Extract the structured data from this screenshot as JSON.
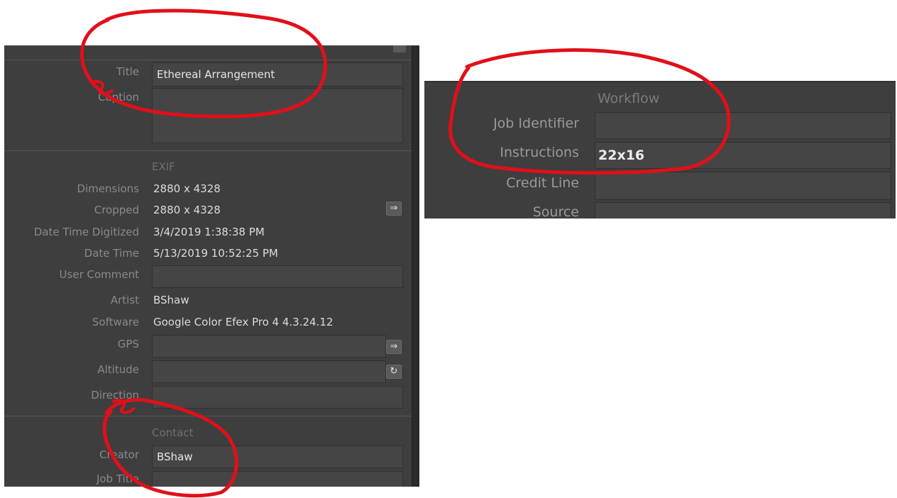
{
  "left_panel": {
    "iptc": {
      "title_label": "Title",
      "title_value": "Ethereal Arrangement",
      "caption_label": "Caption",
      "caption_value": ""
    },
    "exif": {
      "section_title": "EXIF",
      "dimensions_label": "Dimensions",
      "dimensions_value": "2880 x 4328",
      "cropped_label": "Cropped",
      "cropped_value": "2880 x 4328",
      "date_digitized_label": "Date Time Digitized",
      "date_digitized_value": "3/4/2019 1:38:38 PM",
      "date_time_label": "Date Time",
      "date_time_value": "5/13/2019 10:52:25 PM",
      "user_comment_label": "User Comment",
      "user_comment_value": "",
      "artist_label": "Artist",
      "artist_value": "BShaw",
      "software_label": "Software",
      "software_value": "Google Color Efex Pro 4 4.3.24.12",
      "gps_label": "GPS",
      "gps_value": "",
      "altitude_label": "Altitude",
      "altitude_value": "",
      "direction_label": "Direction",
      "direction_value": ""
    },
    "contact": {
      "section_title": "Contact",
      "creator_label": "Creator",
      "creator_value": "BShaw",
      "job_title_label": "Job Title",
      "job_title_value": ""
    },
    "buttons": {
      "arrow_glyph": "⇒",
      "refresh_glyph": "↻"
    }
  },
  "right_panel": {
    "section_title": "Workflow",
    "job_identifier_label": "Job Identifier",
    "job_identifier_value": "",
    "instructions_label": "Instructions",
    "instructions_value": "22x16",
    "credit_line_label": "Credit Line",
    "credit_line_value": "",
    "source_label": "Source",
    "source_value": ""
  },
  "colors": {
    "panel_bg": "#3e3e3e",
    "field_bg": "#454545",
    "label_text": "#8a8a8a",
    "value_text": "#dcdcdc",
    "annotation_red": "#e0101a"
  },
  "icons": {
    "go_to_button": "right-arrow-icon",
    "reset_button": "refresh-icon"
  }
}
